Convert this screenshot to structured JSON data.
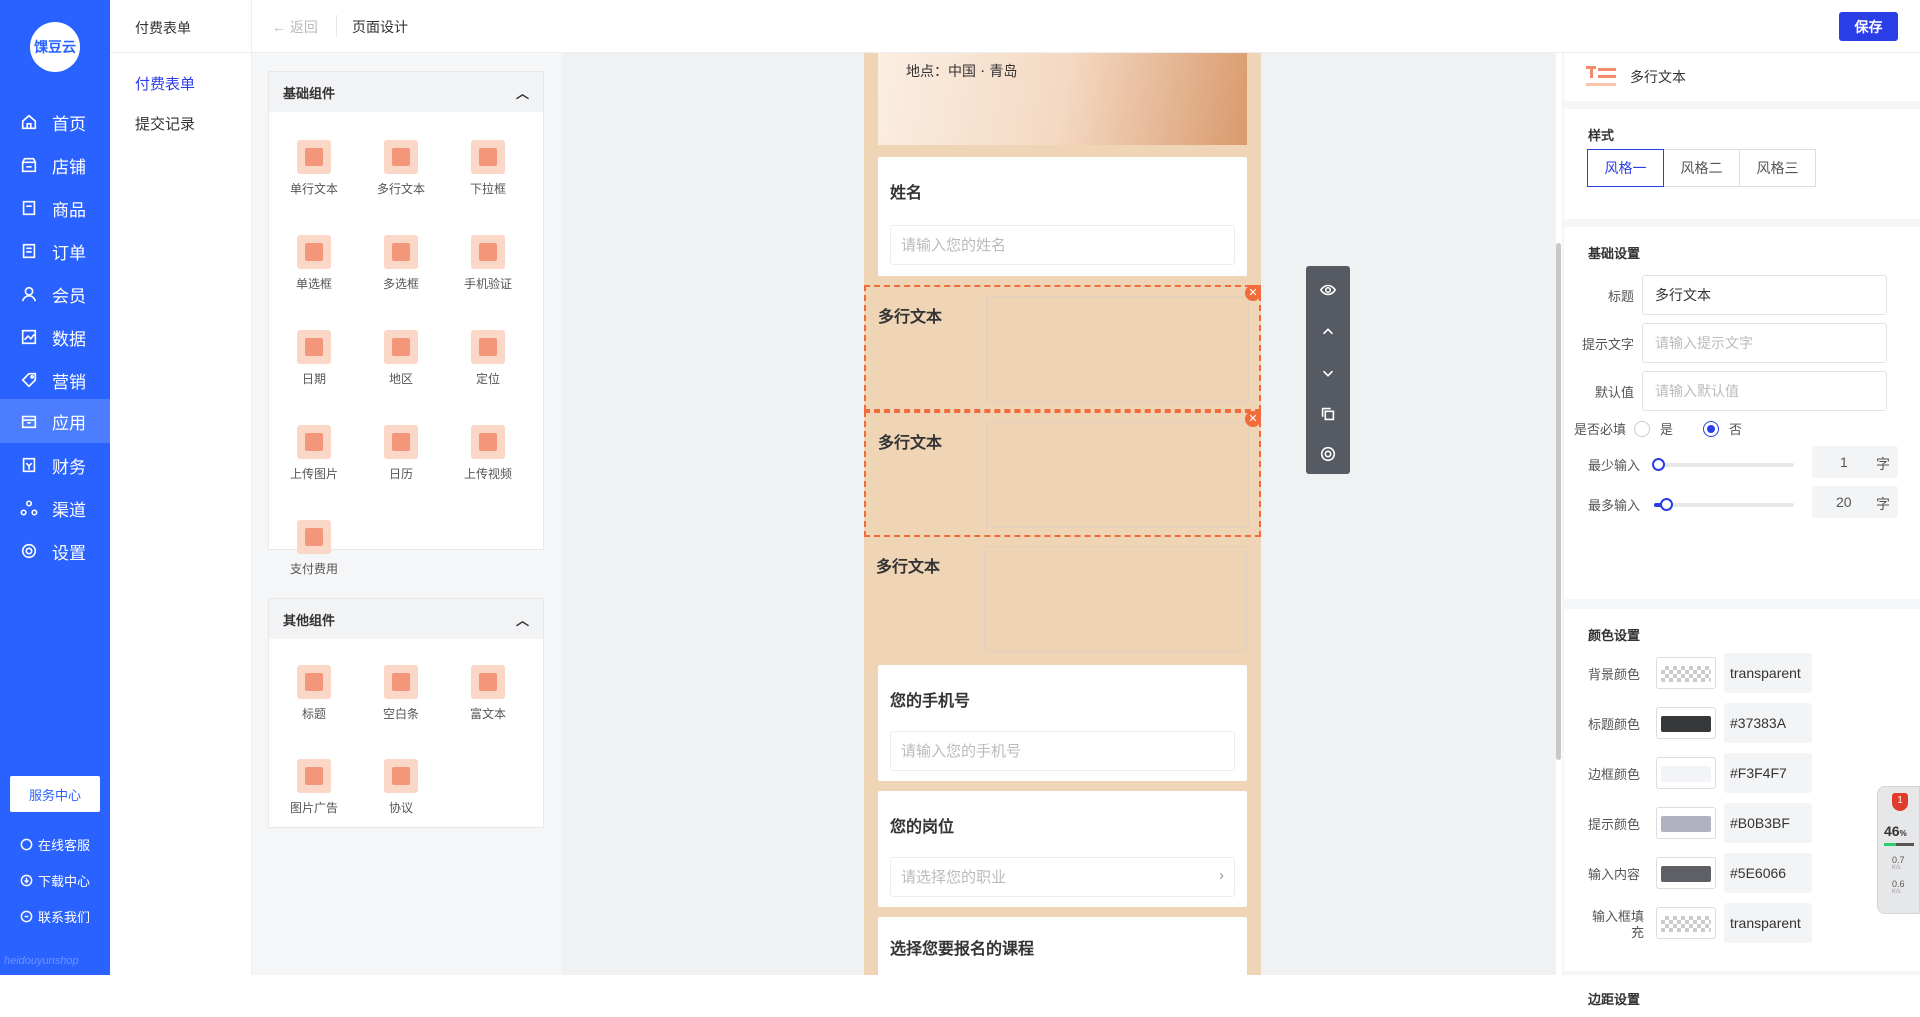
{
  "brand": {
    "logo": "馃豆云",
    "watermark": "heidouyunshop"
  },
  "nav": {
    "items": [
      {
        "label": "首页",
        "icon": "home-icon"
      },
      {
        "label": "店铺",
        "icon": "store-icon"
      },
      {
        "label": "商品",
        "icon": "goods-icon"
      },
      {
        "label": "订单",
        "icon": "order-icon"
      },
      {
        "label": "会员",
        "icon": "user-icon"
      },
      {
        "label": "数据",
        "icon": "chart-icon"
      },
      {
        "label": "营销",
        "icon": "tag-icon"
      },
      {
        "label": "应用",
        "icon": "box-icon"
      },
      {
        "label": "财务",
        "icon": "finance-icon"
      },
      {
        "label": "渠道",
        "icon": "channel-icon"
      },
      {
        "label": "设置",
        "icon": "gear-icon"
      }
    ],
    "active_index": 7,
    "service_center": "服务中心",
    "links": [
      "在线客服",
      "下载中心",
      "联系我们"
    ]
  },
  "subnav": {
    "title": "付费表单",
    "items": [
      "付费表单",
      "提交记录"
    ]
  },
  "topbar": {
    "back": "返回",
    "crumb": "页面设计",
    "save": "保存"
  },
  "components": {
    "basic_title": "基础组件",
    "basic": [
      "单行文本",
      "多行文本",
      "下拉框",
      "单选框",
      "多选框",
      "手机验证",
      "日期",
      "地区",
      "定位",
      "上传图片",
      "日历",
      "上传视频",
      "支付费用"
    ],
    "other_title": "其他组件",
    "other": [
      "标题",
      "空白条",
      "富文本",
      "图片广告",
      "协议"
    ]
  },
  "preview": {
    "location": "地点：中国 · 青岛",
    "name_label": "姓名",
    "name_placeholder": "请输入您的姓名",
    "multiline_label": "多行文本",
    "phone_label": "您的手机号",
    "phone_placeholder": "请输入您的手机号",
    "job_label": "您的岗位",
    "job_placeholder": "请选择您的职业",
    "course_label": "选择您要报名的课程"
  },
  "props": {
    "title": "多行文本",
    "style_title": "样式",
    "styles": [
      "风格一",
      "风格二",
      "风格三"
    ],
    "basic_title": "基础设置",
    "fields": [
      {
        "label": "标题",
        "value": "多行文本",
        "placeholder": ""
      },
      {
        "label": "提示文字",
        "value": "",
        "placeholder": "请输入提示文字"
      },
      {
        "label": "默认值",
        "value": "",
        "placeholder": "请输入默认值"
      }
    ],
    "required_label": "是否必填",
    "yes": "是",
    "no": "否",
    "required": false,
    "min_label": "最少输入",
    "min_value": "1",
    "max_label": "最多输入",
    "max_value": "20",
    "unit": "字",
    "color_title": "颜色设置",
    "colors": [
      {
        "label": "背景颜色",
        "value": "transparent",
        "swatch": "transparent"
      },
      {
        "label": "标题颜色",
        "value": "#37383A",
        "swatch": "#37383A"
      },
      {
        "label": "边框颜色",
        "value": "#F3F4F7",
        "swatch": "#F3F4F7"
      },
      {
        "label": "提示颜色",
        "value": "#B0B3BF",
        "swatch": "#B0B3BF"
      },
      {
        "label": "输入内容",
        "value": "#5E6066",
        "swatch": "#5E6066"
      },
      {
        "label": "输入框填充",
        "value": "transparent",
        "swatch": "transparent"
      }
    ],
    "margin_title": "边距设置"
  },
  "widget": {
    "badge": "1",
    "cpu": "46",
    "up": "0.7",
    "down": "0.6",
    "unit": "K/s"
  }
}
